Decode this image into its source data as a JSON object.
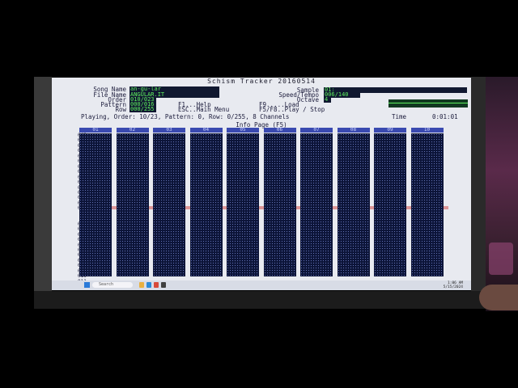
{
  "app": {
    "title": "Schism Tracker 20160514"
  },
  "header": {
    "song_name_label": "Song Name",
    "song_name": "an-gu-lar",
    "file_name_label": "File Name",
    "file_name": "ANGULAR.IT",
    "order_label": "Order",
    "order_value": "010/023",
    "pattern_label": "Pattern",
    "pattern_value": "000/016",
    "row_label": "Row",
    "row_value": "000/255",
    "sample_label": "Sample",
    "sample_value": "01:",
    "speed_label": "Speed/Tempo",
    "speed_value": "006/140",
    "octave_label": "Octave",
    "octave_value": "4",
    "help_f1": "F1...Help",
    "help_esc": "ESC..Main Menu",
    "help_f9": "F9.....Load",
    "help_f5": "F5/F8..Play / Stop",
    "status_playing": "Playing, Order: 10/23, Pattern: 0, Row: 0/255, 8 Channels",
    "time_label": "Time",
    "time_value": "0:01:01"
  },
  "info_page_title": "Info Page (F5)",
  "channels": [
    "01",
    "02",
    "03",
    "04",
    "05",
    "06",
    "07",
    "08",
    "09",
    "10"
  ],
  "row_numbers_top": [
    "049",
    "050",
    "051",
    "052",
    "053",
    "054",
    "055",
    "056",
    "057",
    "058",
    "059",
    "060",
    "061",
    "062",
    "063"
  ],
  "row_numbers_bottom": [
    "000",
    "001",
    "002",
    "003",
    "004",
    "005",
    "006",
    "007",
    "008",
    "009",
    "010",
    "011",
    "012",
    "013",
    "014",
    "015",
    "016",
    "017",
    "018",
    "019"
  ],
  "taskbar": {
    "search_placeholder": "Search",
    "clock_time": "1:06 AM",
    "clock_date": "5/15/2024"
  },
  "colors": {
    "field_bg": "#101830",
    "field_text": "#5ef05e",
    "pattern_bg": "#0c1438",
    "cursor_row": "#d88080"
  }
}
